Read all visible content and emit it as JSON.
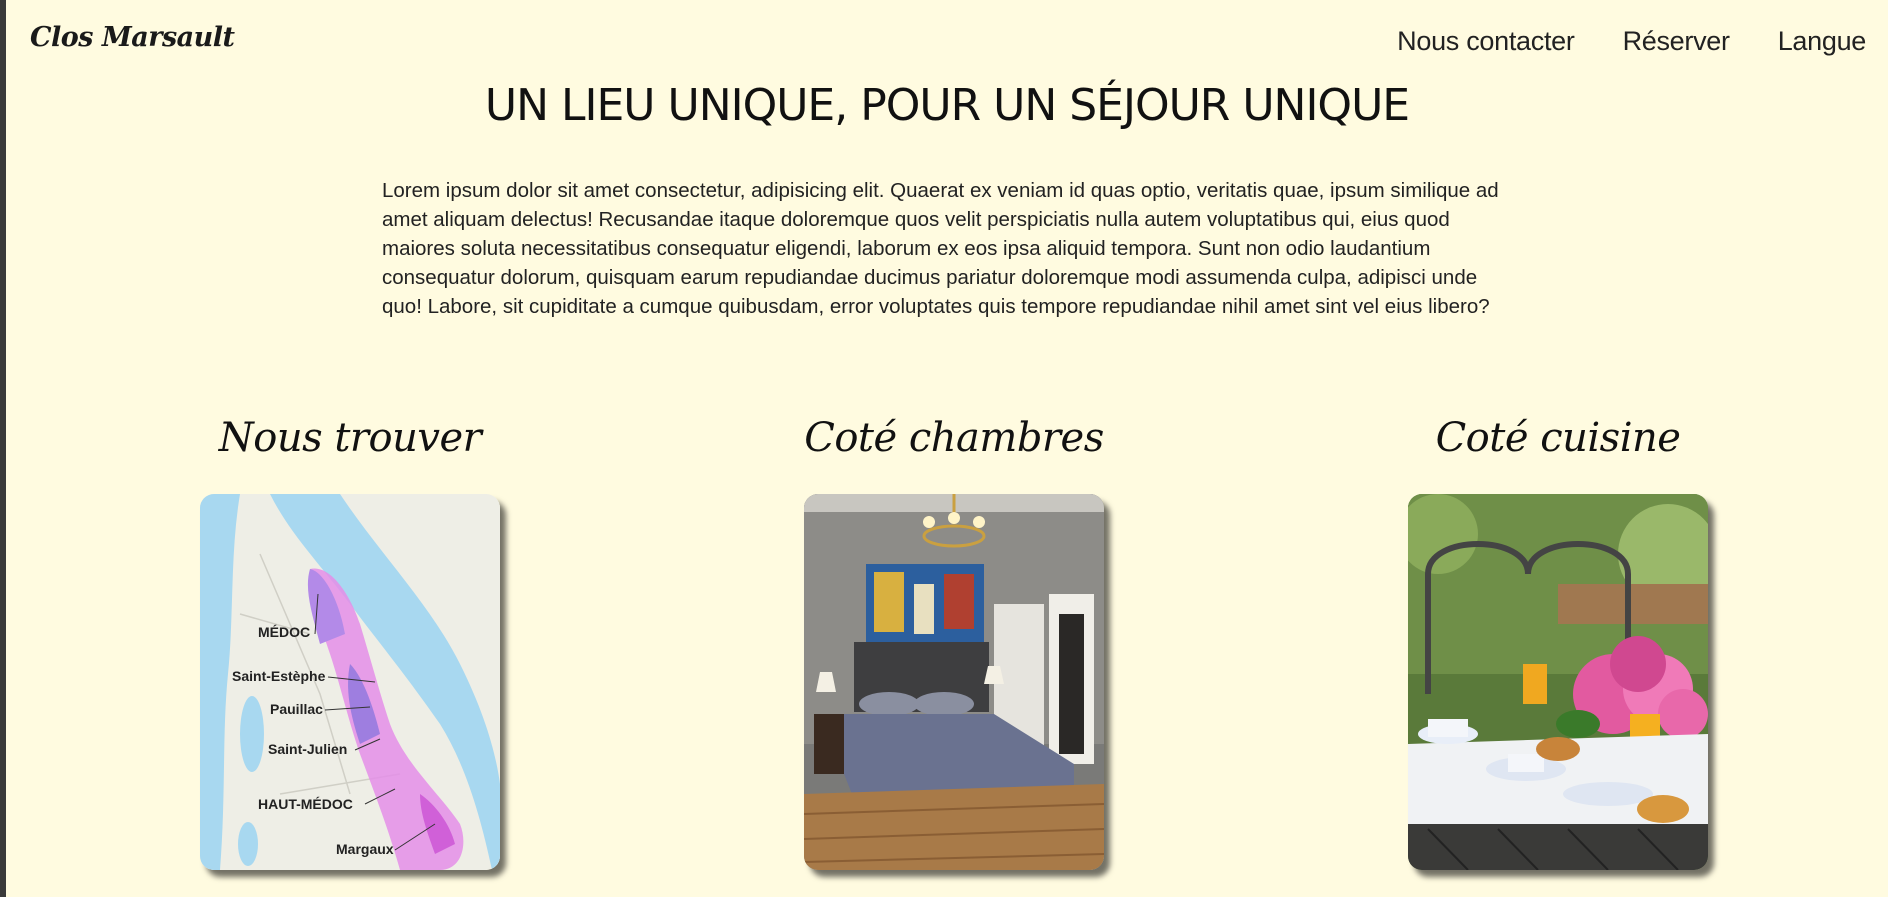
{
  "brand": "Clos Marsault",
  "nav": {
    "contact": "Nous contacter",
    "book": "Réserver",
    "language": "Langue"
  },
  "headline": "UN LIEU UNIQUE, POUR UN SÉJOUR UNIQUE",
  "intro": "Lorem ipsum dolor sit amet consectetur, adipisicing elit. Quaerat ex veniam id quas optio, veritatis quae, ipsum similique ad amet aliquam delectus! Recusandae itaque doloremque quos velit perspiciatis nulla autem voluptatibus qui, eius quod maiores soluta necessitatibus consequatur eligendi, laborum ex eos ipsa aliquid tempora. Sunt non odio laudantium consequatur dolorum, quisquam earum repudiandae ducimus pariatur doloremque modi assumenda culpa, adipisci unde quo! Labore, sit cupiditate a cumque quibusdam, error voluptates quis tempore repudiandae nihil amet sint vel eius libero?",
  "cards": [
    {
      "title": "Nous trouver",
      "map_labels": [
        "MÉDOC",
        "Saint-Estèphe",
        "Pauillac",
        "Saint-Julien",
        "HAUT-MÉDOC",
        "Margaux"
      ]
    },
    {
      "title": "Coté chambres"
    },
    {
      "title": "Coté cuisine"
    }
  ],
  "colors": {
    "page_background": "#fffbe0",
    "map_water": "#a8d8f0",
    "map_vineyard": "#e48ee8"
  }
}
